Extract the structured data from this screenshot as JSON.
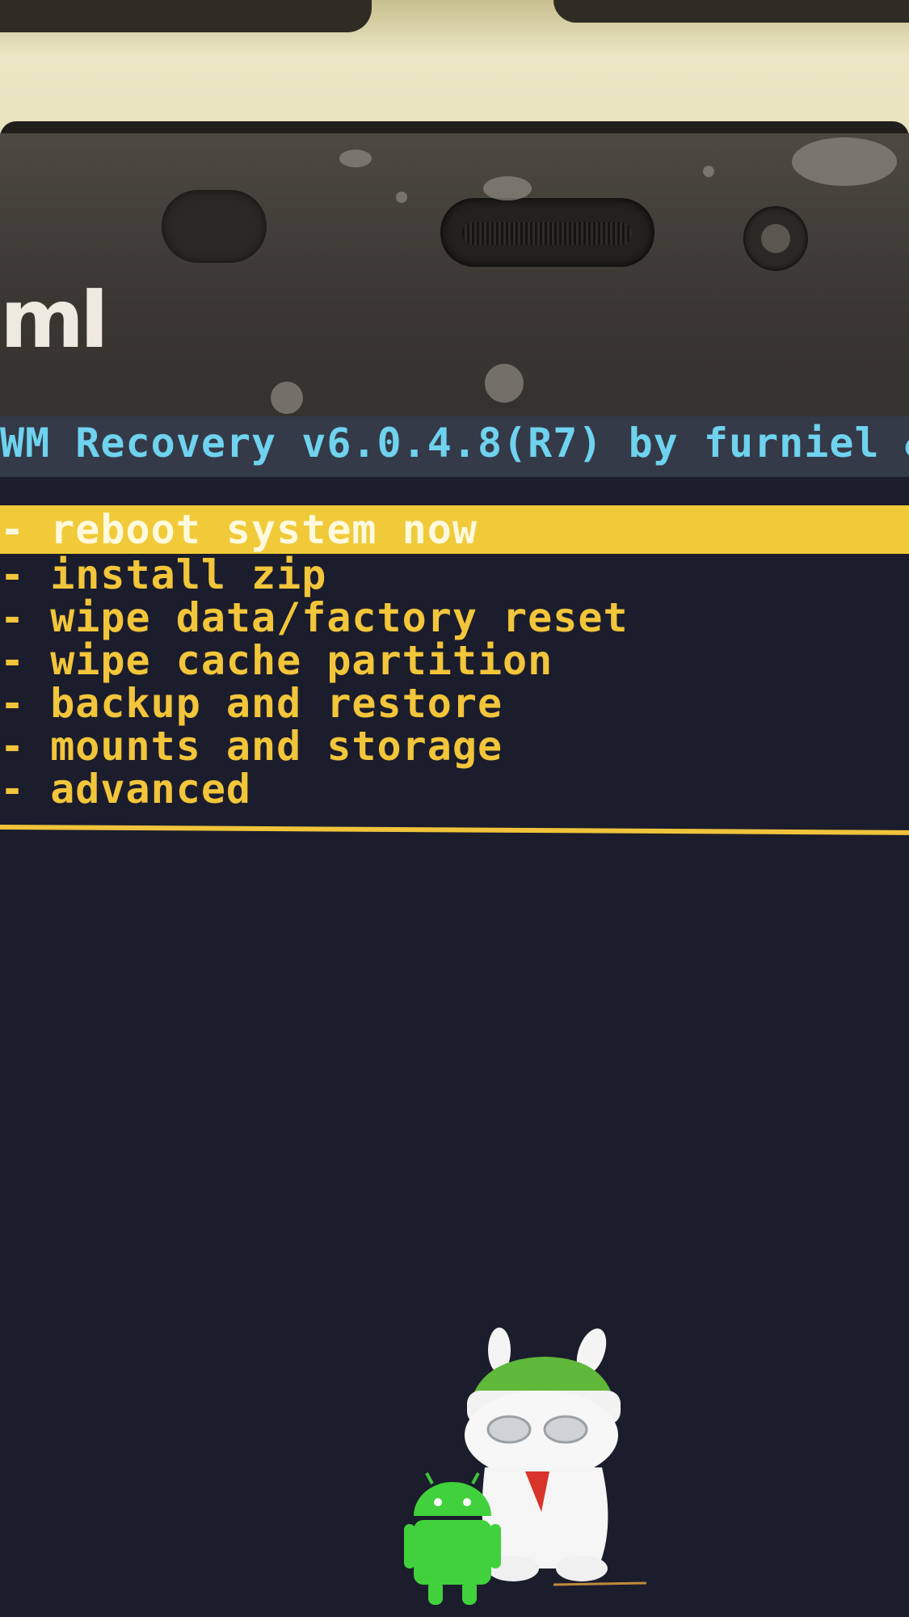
{
  "device": {
    "brand_logo": "mI"
  },
  "recovery": {
    "title": "WM Recovery v6.0.4.8(R7) by furniel &",
    "menu": [
      {
        "label": "- reboot system now"
      },
      {
        "label": "- install zip"
      },
      {
        "label": "- wipe data/factory reset"
      },
      {
        "label": "- wipe cache partition"
      },
      {
        "label": "- backup and restore"
      },
      {
        "label": "- mounts and storage"
      },
      {
        "label": "- advanced"
      }
    ],
    "selected_index": 0
  },
  "colors": {
    "header_text": "#6fd2ee",
    "menu_text": "#f2c53a",
    "highlight": "#f0ca38",
    "background": "#1b1d2c"
  },
  "icons": [
    "mi-bunny-mascot-icon",
    "android-robot-icon"
  ]
}
